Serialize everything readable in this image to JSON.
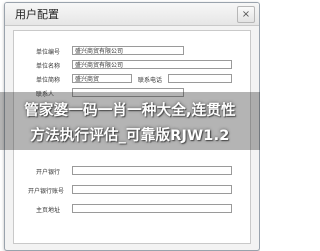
{
  "window": {
    "title": "用户配置",
    "close_glyph": "×"
  },
  "form": {
    "row1": {
      "label": "单位编号",
      "value": "盛兴商贸有限公司"
    },
    "row2": {
      "label": "单位名称",
      "value": "盛兴商贸有限公司"
    },
    "row3": {
      "label": "单位简称",
      "value": "盛兴商贸",
      "extra_label": "联系电话",
      "extra_value": ""
    },
    "row4": {
      "label": "联系人",
      "value": ""
    },
    "row5": {
      "label": "开户银行",
      "value": ""
    },
    "row6": {
      "label": "开户银行账号",
      "value": ""
    },
    "row7": {
      "label": "主页地址",
      "value": ""
    }
  },
  "overlay": {
    "line1": "管家婆一码一肖一种大全,连贯性",
    "line2": "方法执行评估_可靠版RJW1.2"
  }
}
